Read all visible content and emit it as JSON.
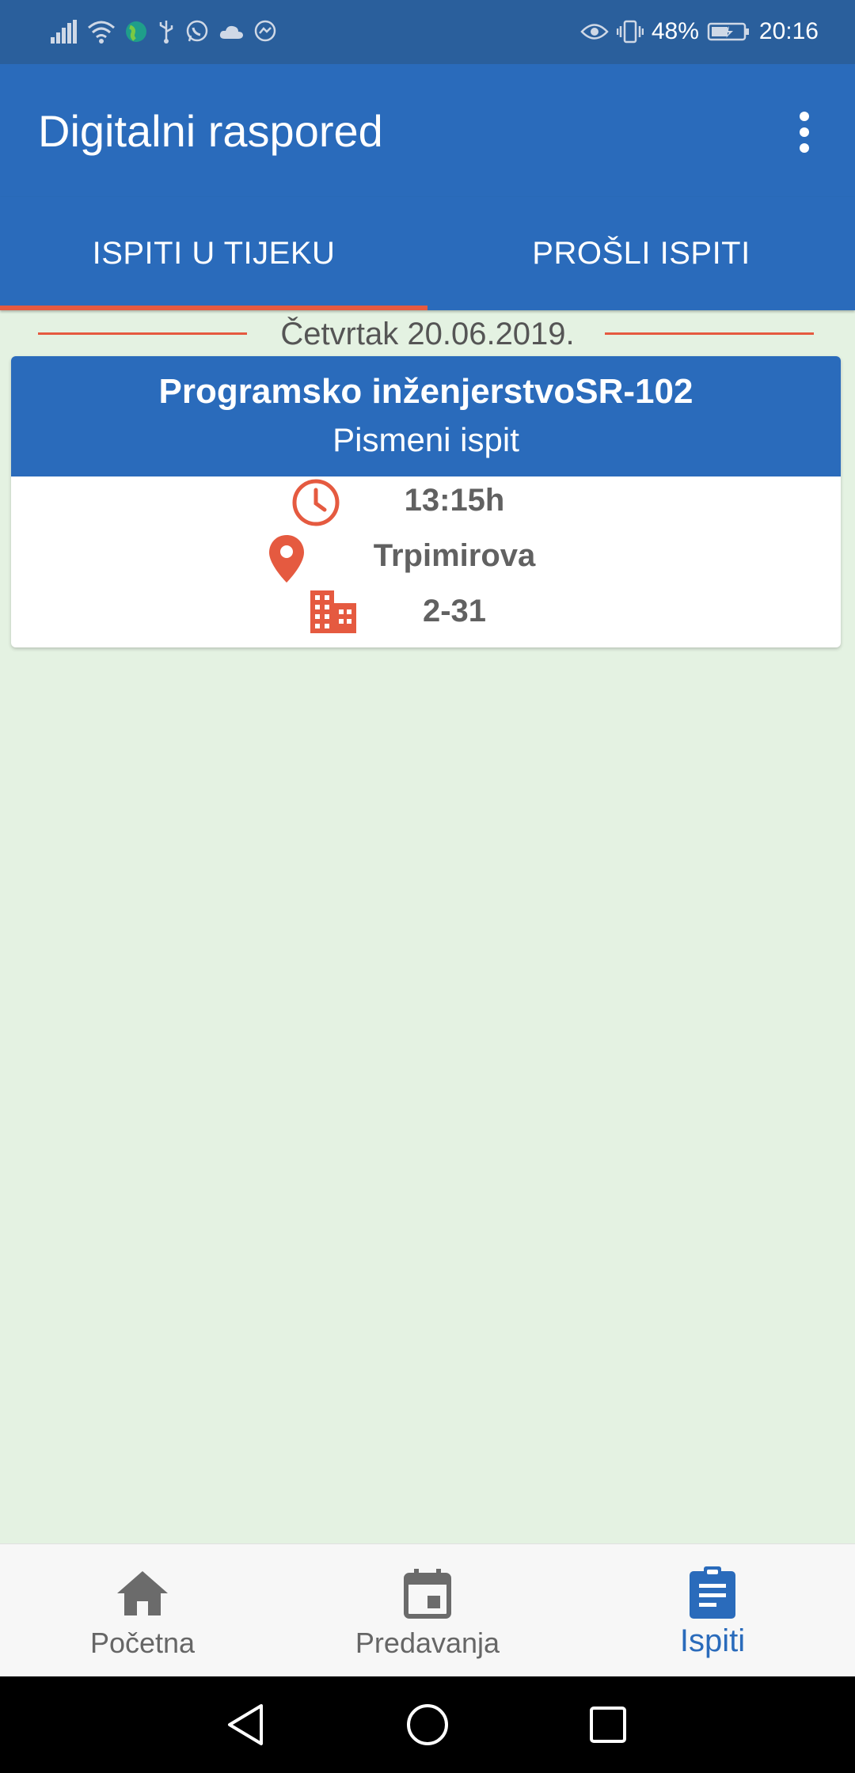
{
  "status_bar": {
    "battery": "48%",
    "time": "20:16"
  },
  "app_bar": {
    "title": "Digitalni raspored"
  },
  "tabs": [
    {
      "label": "ISPITI U TIJEKU",
      "selected": true
    },
    {
      "label": "PROŠLI ISPITI",
      "selected": false
    }
  ],
  "date_header": "Četvrtak 20.06.2019.",
  "exam": {
    "course": "Programsko inženjerstvoSR-102",
    "type": "Pismeni ispit",
    "time": "13:15h",
    "location": "Trpimirova",
    "room": "2-31"
  },
  "bottom_nav": [
    {
      "label": "Početna",
      "icon": "home-icon",
      "active": false
    },
    {
      "label": "Predavanja",
      "icon": "calendar-icon",
      "active": false
    },
    {
      "label": "Ispiti",
      "icon": "clipboard-icon",
      "active": true
    }
  ],
  "colors": {
    "primary": "#2a6bbb",
    "status_bar": "#2a5f9c",
    "accent": "#e55a40",
    "background": "#e4f2e2"
  }
}
